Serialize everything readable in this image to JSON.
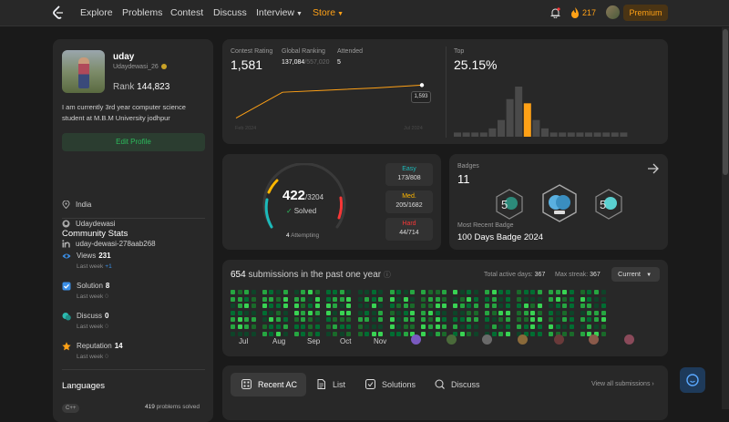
{
  "nav": {
    "items": [
      "Explore",
      "Problems",
      "Contest",
      "Discuss",
      "Interview",
      "Store"
    ],
    "streak": "217",
    "premium": "Premium"
  },
  "profile": {
    "name": "uday",
    "handle": "Udaydewasi_26",
    "rank_label": "Rank",
    "rank_value": "144,823",
    "bio": "I am currently 3rd year computer science student at M.B.M University jodhpur",
    "edit_label": "Edit Profile",
    "location": "India",
    "github": "Udaydewasi",
    "linkedin": "uday-dewasi-278aab268"
  },
  "community": {
    "title": "Community Stats",
    "stats": [
      {
        "label": "Views",
        "value": "231",
        "lw_label": "Last week",
        "lw_value": "+1",
        "color": "#3a8ee6"
      },
      {
        "label": "Solution",
        "value": "8",
        "lw_label": "Last week",
        "lw_value": "0",
        "color": "#3a8ee6"
      },
      {
        "label": "Discuss",
        "value": "0",
        "lw_label": "Last week",
        "lw_value": "0",
        "color": "#2cbbb0"
      },
      {
        "label": "Reputation",
        "value": "14",
        "lw_label": "Last week",
        "lw_value": "0",
        "color": "#ffa116"
      }
    ]
  },
  "languages": {
    "title": "Languages",
    "items": [
      {
        "name": "C++",
        "count": "419",
        "suffix": "problems solved"
      }
    ]
  },
  "contest": {
    "rating_label": "Contest Rating",
    "rating": "1,581",
    "global_label": "Global Ranking",
    "global_value": "137,084",
    "global_total": "/557,020",
    "attended_label": "Attended",
    "attended": "5",
    "tooltip": "1,593",
    "axis_start": "Feb 2024",
    "axis_end": "Jul 2024",
    "top_label": "Top",
    "top_value": "25.15%"
  },
  "chart_data": [
    {
      "type": "line",
      "x": [
        "Feb 2024",
        "",
        "",
        "",
        "Jul 2024"
      ],
      "values": [
        1440,
        1560,
        1570,
        1580,
        1593
      ],
      "ylim": [
        1400,
        1620
      ]
    },
    {
      "type": "bar",
      "values": [
        1,
        1,
        1,
        1,
        2,
        4,
        9,
        12,
        8,
        4,
        2,
        1,
        1,
        1,
        1,
        1,
        1,
        1,
        1,
        1
      ],
      "highlight_index": 8,
      "colors": {
        "bar": "#4a4a4a",
        "highlight": "#ffa116"
      }
    }
  ],
  "solved": {
    "count": "422",
    "total": "/3204",
    "solved_label": "Solved",
    "attempting_count": "4",
    "attempting_label": "Attempting",
    "easy": {
      "label": "Easy",
      "value": "173/808",
      "color": "#1cbaba"
    },
    "medium": {
      "label": "Med.",
      "value": "205/1682",
      "color": "#ffb700"
    },
    "hard": {
      "label": "Hard",
      "value": "44/714",
      "color": "#f63737"
    }
  },
  "badges": {
    "label": "Badges",
    "count": "11",
    "recent_label": "Most Recent Badge",
    "recent": "100 Days Badge 2024"
  },
  "submissions": {
    "count": "654",
    "label": "submissions in the past one year",
    "active_label": "Total active days:",
    "active_value": "367",
    "streak_label": "Max streak:",
    "streak_value": "367",
    "period": "Current",
    "months": [
      "Jul",
      "Aug",
      "Sep",
      "Oct",
      "Nov"
    ]
  },
  "tabs": {
    "items": [
      "Recent AC",
      "List",
      "Solutions",
      "Discuss"
    ],
    "view_all": "View all submissions"
  }
}
